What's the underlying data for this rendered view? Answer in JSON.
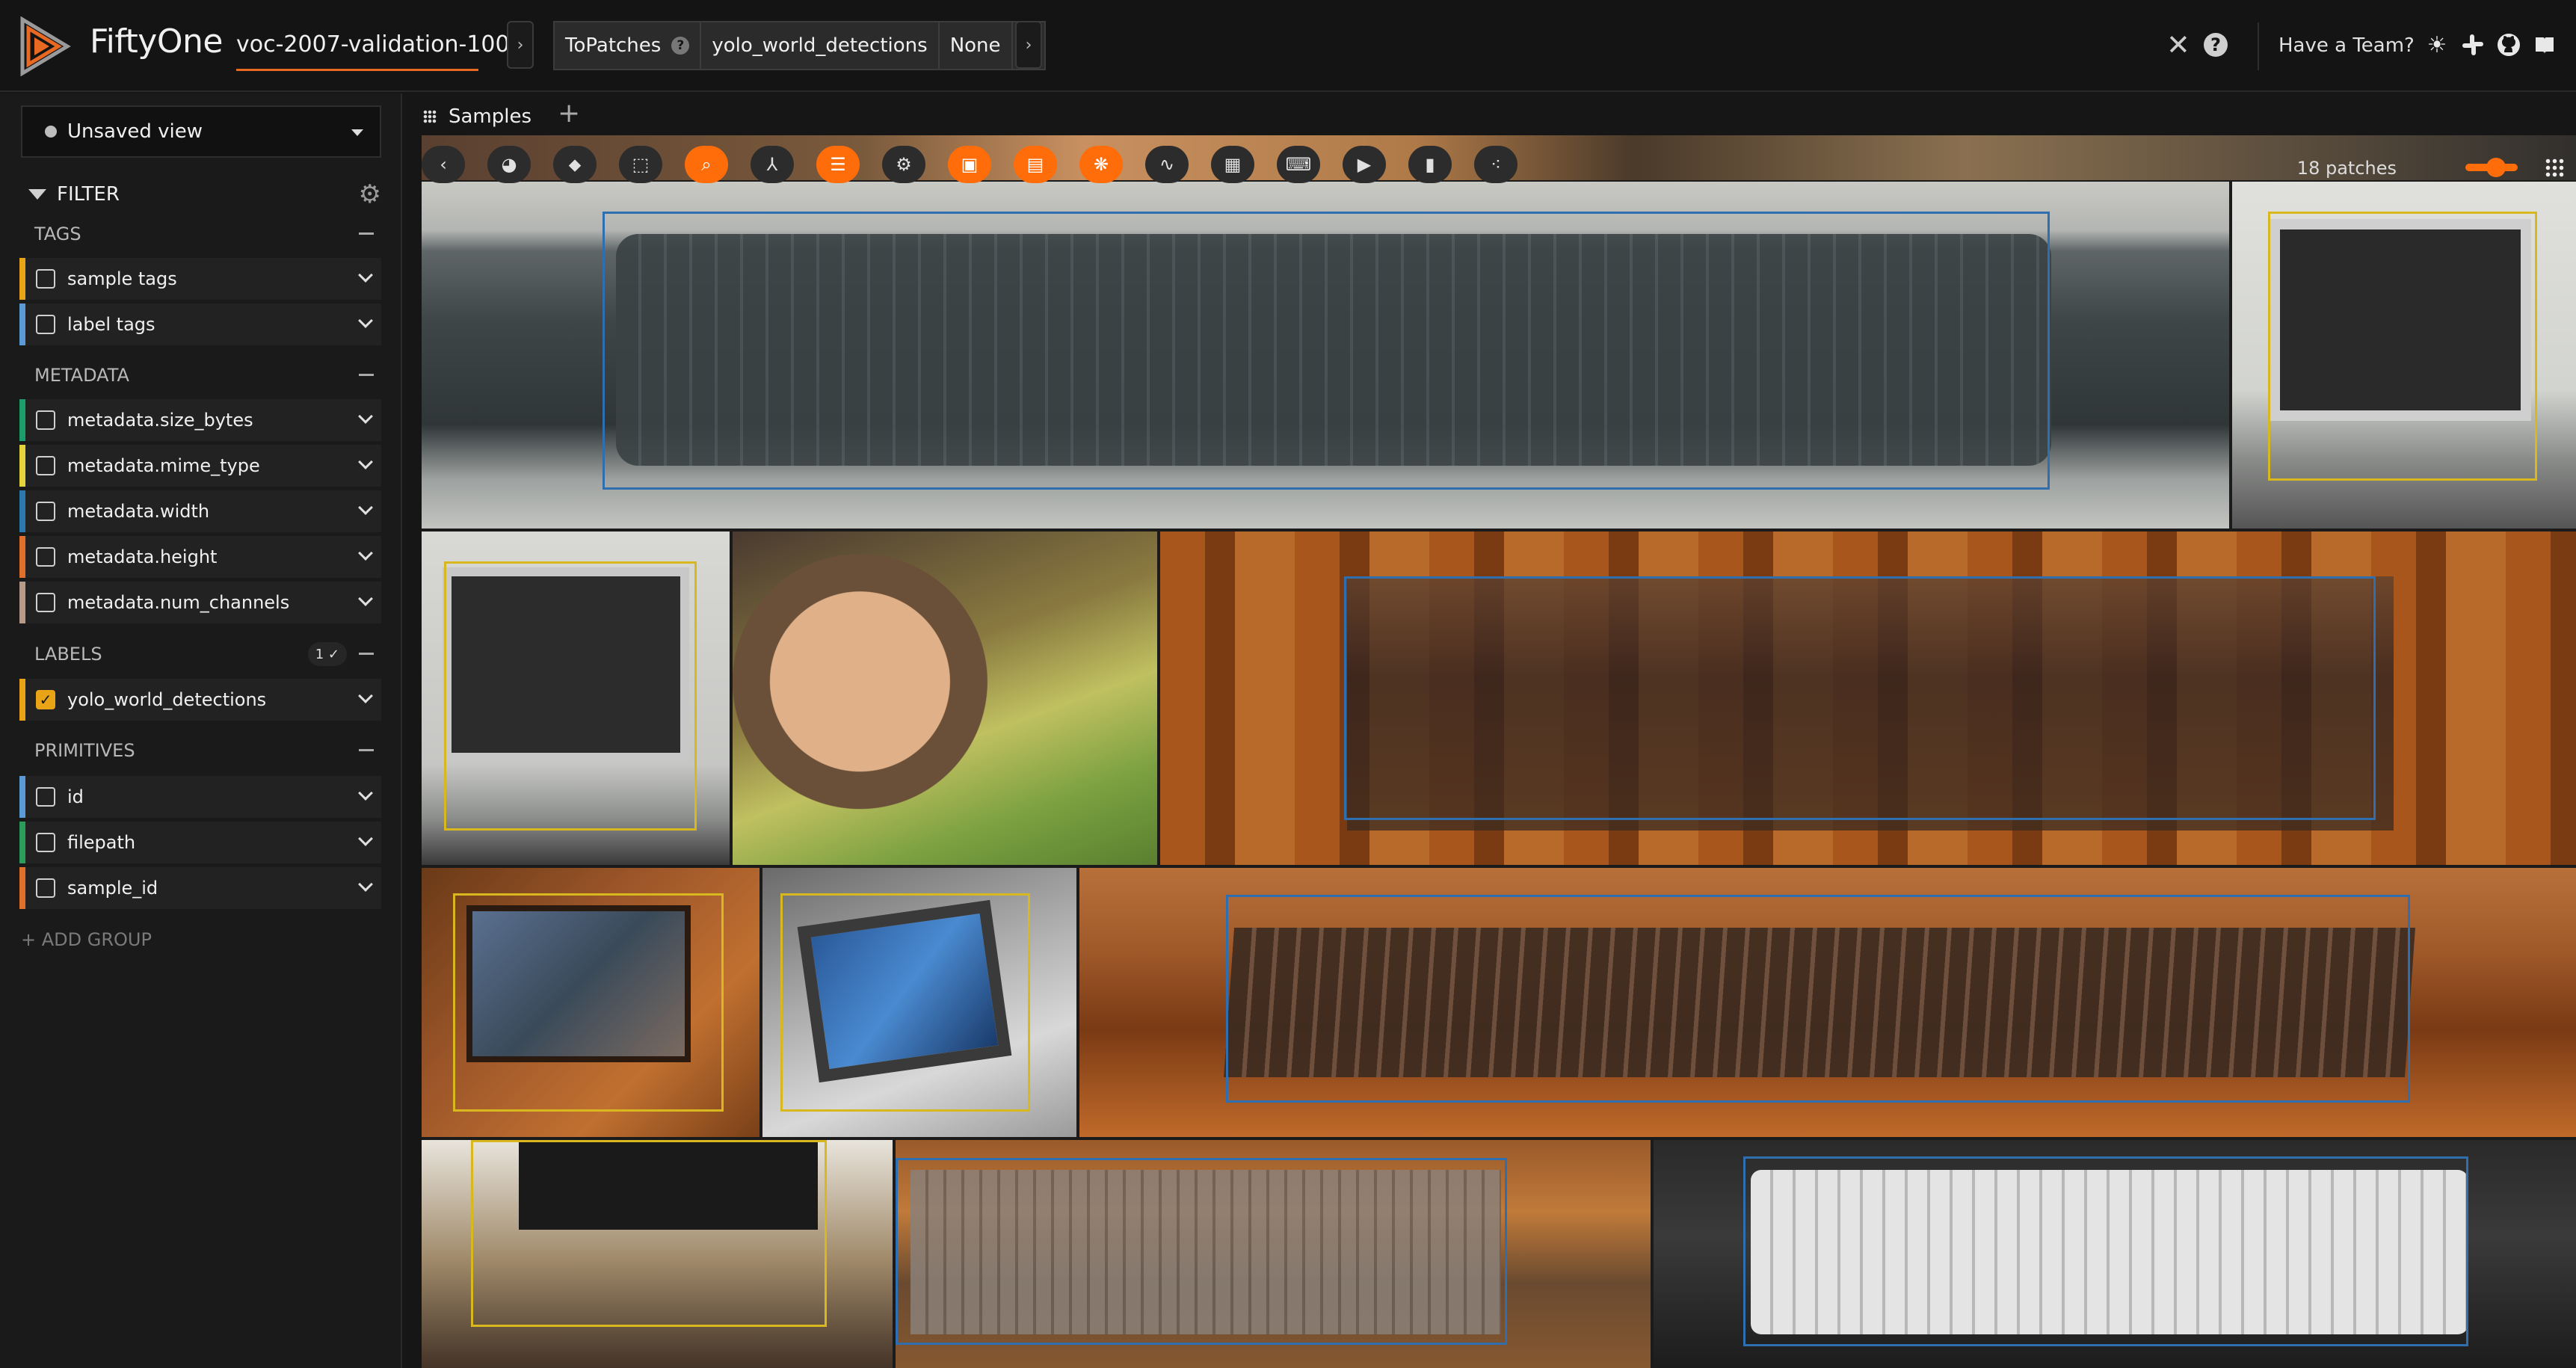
{
  "header": {
    "app_name": "FiftyOne",
    "dataset_name": "voc-2007-validation-100",
    "stages": [
      {
        "name": "ToPatches",
        "help": "?"
      },
      {
        "name": "yolo_world_detections"
      },
      {
        "name": "None"
      }
    ],
    "close_glyph": "✕",
    "help_glyph": "?",
    "team_link": "Have a Team?",
    "icons": [
      "theme-toggle-icon",
      "slack-icon",
      "github-icon",
      "docs-icon"
    ]
  },
  "sidebar": {
    "view_selector": "Unsaved view",
    "filter_label": "FILTER",
    "groups": {
      "tags": "TAGS",
      "metadata": "METADATA",
      "labels": "LABELS",
      "labels_badge": "1 ✓",
      "primitives": "PRIMITIVES"
    },
    "fields": {
      "sample_tags": "sample tags",
      "label_tags": "label tags",
      "size_bytes": "metadata.size_bytes",
      "mime_type": "metadata.mime_type",
      "width": "metadata.width",
      "height": "metadata.height",
      "num_channels": "metadata.num_channels",
      "yolo": "yolo_world_detections",
      "id": "id",
      "filepath": "filepath",
      "sample_id": "sample_id"
    },
    "field_colors": {
      "sample_tags": "#e8a317",
      "label_tags": "#5b9bd5",
      "size_bytes": "#1a9e6a",
      "mime_type": "#e6d23a",
      "width": "#2a7ab0",
      "height": "#e0702a",
      "num_channels": "#b89a8a",
      "yolo": "#e8a317",
      "id": "#5b9bd5",
      "filepath": "#2a9d5a",
      "sample_id": "#e0702a"
    },
    "yolo_checked": true,
    "add_group": "+ ADD GROUP"
  },
  "main": {
    "tab_label": "Samples",
    "add_tab": "+",
    "patch_count": "18 patches"
  },
  "colors": {
    "accent": "#ff6d0a",
    "brand_orange": "#e86a22",
    "box_blue": "#2f6fb0",
    "box_yellow": "#d9b81f"
  }
}
